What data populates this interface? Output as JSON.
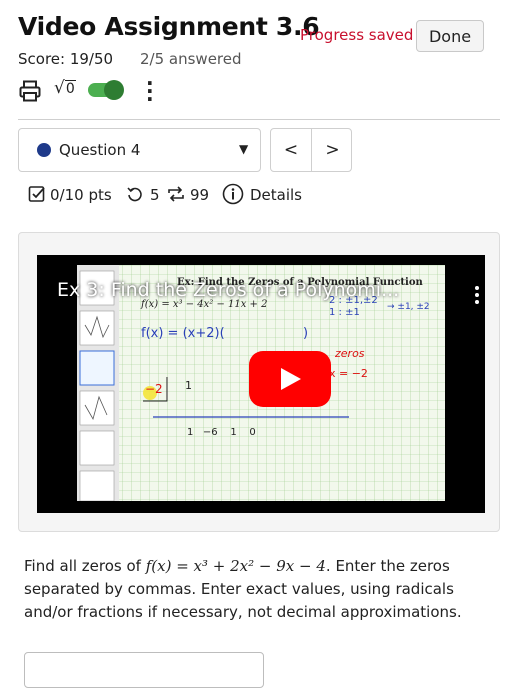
{
  "header": {
    "title": "Video Assignment 3.6",
    "progress_status": "Progress saved",
    "done_label": "Done",
    "score": "Score: 19/50",
    "answered": "2/5 answered"
  },
  "tools": {
    "sqrt_label": "√",
    "sqrt_box": "0",
    "math_toggle_on": true
  },
  "question_nav": {
    "selected": "Question 4",
    "prev_label": "<",
    "next_label": ">"
  },
  "meta": {
    "points": "0/10 pts",
    "attempts": "5",
    "retries": "99",
    "details_label": "Details"
  },
  "video": {
    "title": "Ex 3: Find the Zeros of a Polynomi...",
    "slide_heading": "Ex: Find the Zeros of a Polynomial Function",
    "slide_fx": "f(x) = x³ − 4x² − 11x + 2",
    "slide_roots": "2 : ±1,±2",
    "slide_roots2": "1 : ±1",
    "slide_roots3": "→ ±1, ±2",
    "slide_factor": "f(x) = (x+2)(",
    "slide_factor_end": ")",
    "slide_zeros": "zeros",
    "slide_zero_x": "x = −2",
    "slide_synth_divisor": "−2",
    "slide_synth_top": "1",
    "slide_synth_bottom": "1   −6    1    0"
  },
  "prompt": {
    "before": "Find all zeros of ",
    "function": "f(x) = x³ + 2x² − 9x − 4",
    "after": ". Enter the zeros separated by commas. Enter exact values, using radicals and/or fractions if necessary, not decimal approximations."
  },
  "answer": {
    "value": "",
    "placeholder": ""
  },
  "colors": {
    "progress": "#c8102e",
    "toggle": "#4caf50",
    "question_dot": "#1e3a8a",
    "play_button": "#ff0000"
  }
}
